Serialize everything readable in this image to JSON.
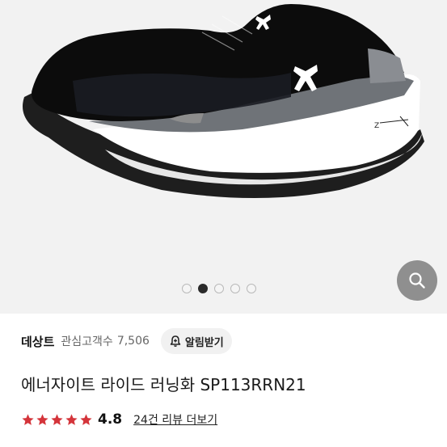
{
  "brand": "데상트",
  "interest": {
    "label": "관심고객수",
    "count": "7,506"
  },
  "notify_button": {
    "label": "알림받기",
    "icon": "bell-plus-icon"
  },
  "product_title": "에너자이트 라이드 러닝화 SP113RRN21",
  "rating": {
    "value": "4.8",
    "stars": 5,
    "star_color": "#d4343a"
  },
  "reviews_link": "24건 리뷰 더보기",
  "carousel": {
    "total": 5,
    "active_index": 1
  },
  "zoom_button": {
    "icon": "search-icon"
  },
  "shoe_logo_text": "Z"
}
